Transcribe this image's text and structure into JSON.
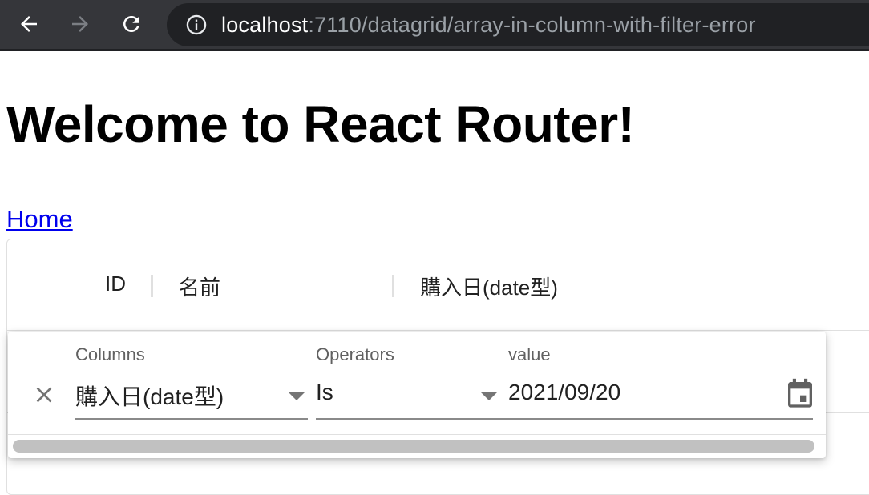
{
  "browser": {
    "url_host": "localhost",
    "url_path": ":7110/datagrid/array-in-column-with-filter-error",
    "icons": [
      "back-arrow-icon",
      "forward-arrow-icon",
      "reload-icon",
      "info-icon"
    ]
  },
  "page": {
    "title": "Welcome to React Router!",
    "home_link": "Home"
  },
  "grid": {
    "columns": [
      "ID",
      "名前",
      "購入日(date型)"
    ]
  },
  "filter": {
    "columns_label": "Columns",
    "columns_value": "購入日(date型)",
    "operators_label": "Operators",
    "operators_value": "Is",
    "value_label": "value",
    "value_value": "2021/09/20",
    "icons": [
      "close-icon",
      "chevron-down-icon",
      "calendar-icon"
    ]
  }
}
